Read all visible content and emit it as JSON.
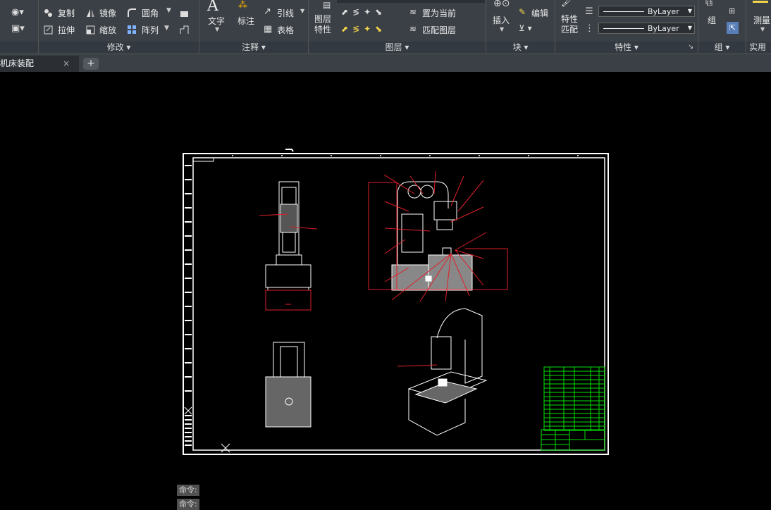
{
  "modify": {
    "title": "修改",
    "copy": "复制",
    "mirror": "镜像",
    "fillet": "圆角",
    "stretch": "拉伸",
    "scale": "缩放",
    "array": "阵列"
  },
  "annotation": {
    "title": "注释",
    "text": "文字",
    "dimension": "标注",
    "leader": "引线",
    "table": "表格"
  },
  "layers": {
    "title": "图层",
    "layer_properties": "图层\n特性",
    "set_current": "置为当前",
    "match_layer": "匹配图层"
  },
  "block": {
    "title": "块",
    "insert": "插入",
    "edit": "编辑"
  },
  "properties": {
    "title": "特性",
    "match": "特性\n匹配",
    "linetype": "ByLayer",
    "lineweight": "ByLayer"
  },
  "group": {
    "title": "组",
    "group": "组"
  },
  "utilities": {
    "title": "实用工",
    "measure": "测量"
  },
  "tabs": {
    "active": "机床装配",
    "close": "×",
    "new": "+"
  },
  "command": {
    "line1": "命令:",
    "line2": "命令:"
  },
  "colors": {
    "ribbon": "#3b4046",
    "canvas": "#000000",
    "dim": "#e0202a",
    "titleblock": "#00e000",
    "drawing": "#ffffff"
  }
}
